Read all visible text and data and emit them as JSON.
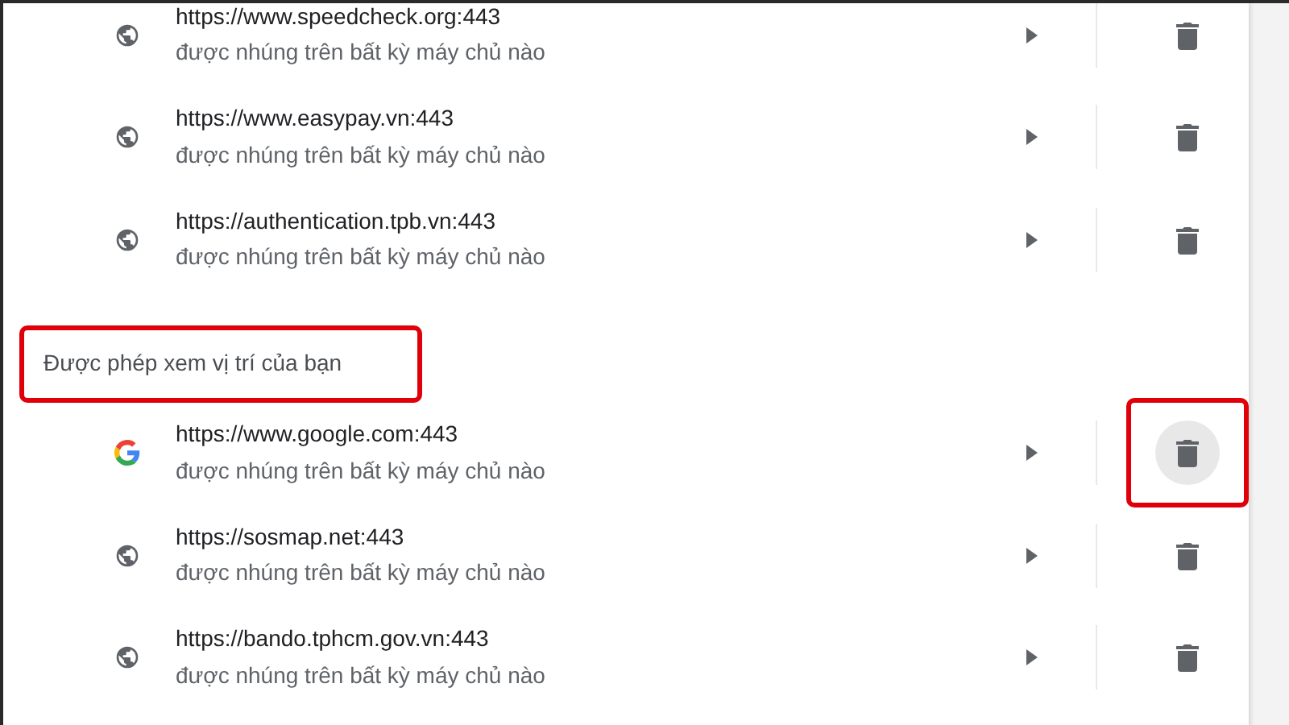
{
  "sections": [
    {
      "sites": [
        {
          "kind": "globe",
          "url": "https://www.speedcheck.org:443",
          "detail": "được nhúng trên bất kỳ máy chủ nào",
          "delete_highlighted": false
        },
        {
          "kind": "globe",
          "url": "https://www.easypay.vn:443",
          "detail": "được nhúng trên bất kỳ máy chủ nào",
          "delete_highlighted": false
        },
        {
          "kind": "globe",
          "url": "https://authentication.tpb.vn:443",
          "detail": "được nhúng trên bất kỳ máy chủ nào",
          "delete_highlighted": false
        }
      ]
    },
    {
      "heading": "Được phép xem vị trí của bạn",
      "highlighted": true,
      "sites": [
        {
          "kind": "google",
          "url": "https://www.google.com:443",
          "detail": "được nhúng trên bất kỳ máy chủ nào",
          "delete_highlighted": true
        },
        {
          "kind": "globe",
          "url": "https://sosmap.net:443",
          "detail": "được nhúng trên bất kỳ máy chủ nào",
          "delete_highlighted": false
        },
        {
          "kind": "globe",
          "url": "https://bando.tphcm.gov.vn:443",
          "detail": "được nhúng trên bất kỳ máy chủ nào",
          "delete_highlighted": false
        }
      ]
    }
  ]
}
